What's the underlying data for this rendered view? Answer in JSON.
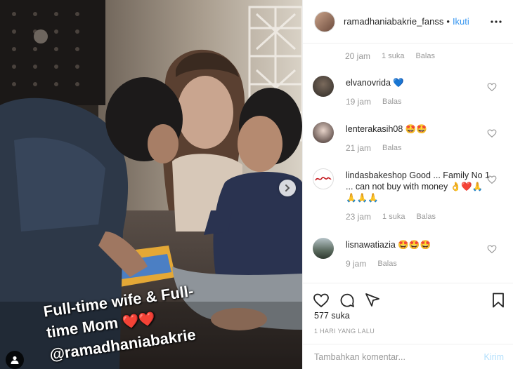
{
  "post": {
    "caption_line1": "Full-time wife & Full-",
    "caption_line2": "time Mom",
    "caption_hearts": "❤️❤️",
    "caption_line3": "@ramadhaniabakrie"
  },
  "header": {
    "username": "ramadhaniabakrie_fanss",
    "separator": "•",
    "follow_label": "Ikuti"
  },
  "top_comment_meta": {
    "time": "20 jam",
    "likes": "1 suka",
    "reply": "Balas"
  },
  "comments": [
    {
      "username": "elvanovrida",
      "text": "💙",
      "time": "19 jam",
      "likes": "",
      "reply": "Balas"
    },
    {
      "username": "lenterakasih08",
      "text": "🤩🤩",
      "time": "21 jam",
      "likes": "",
      "reply": "Balas"
    },
    {
      "username": "lindasbakeshop",
      "text": "Good ... Family No 1 ... can not buy with money 👌❤️🙏🙏🙏🙏",
      "time": "23 jam",
      "likes": "1 suka",
      "reply": "Balas"
    },
    {
      "username": "lisnawatiazia",
      "text": "🤩🤩🤩",
      "time": "9 jam",
      "likes": "",
      "reply": "Balas"
    }
  ],
  "actions": {
    "like_count": "577 suka",
    "date": "1 HARI YANG LALU"
  },
  "add_comment": {
    "placeholder": "Tambahkan komentar...",
    "post_label": "Kirim"
  },
  "colors": {
    "link_blue": "#3897f0",
    "post_disabled": "#b2dffc",
    "muted": "#999999",
    "border": "#efefef"
  }
}
